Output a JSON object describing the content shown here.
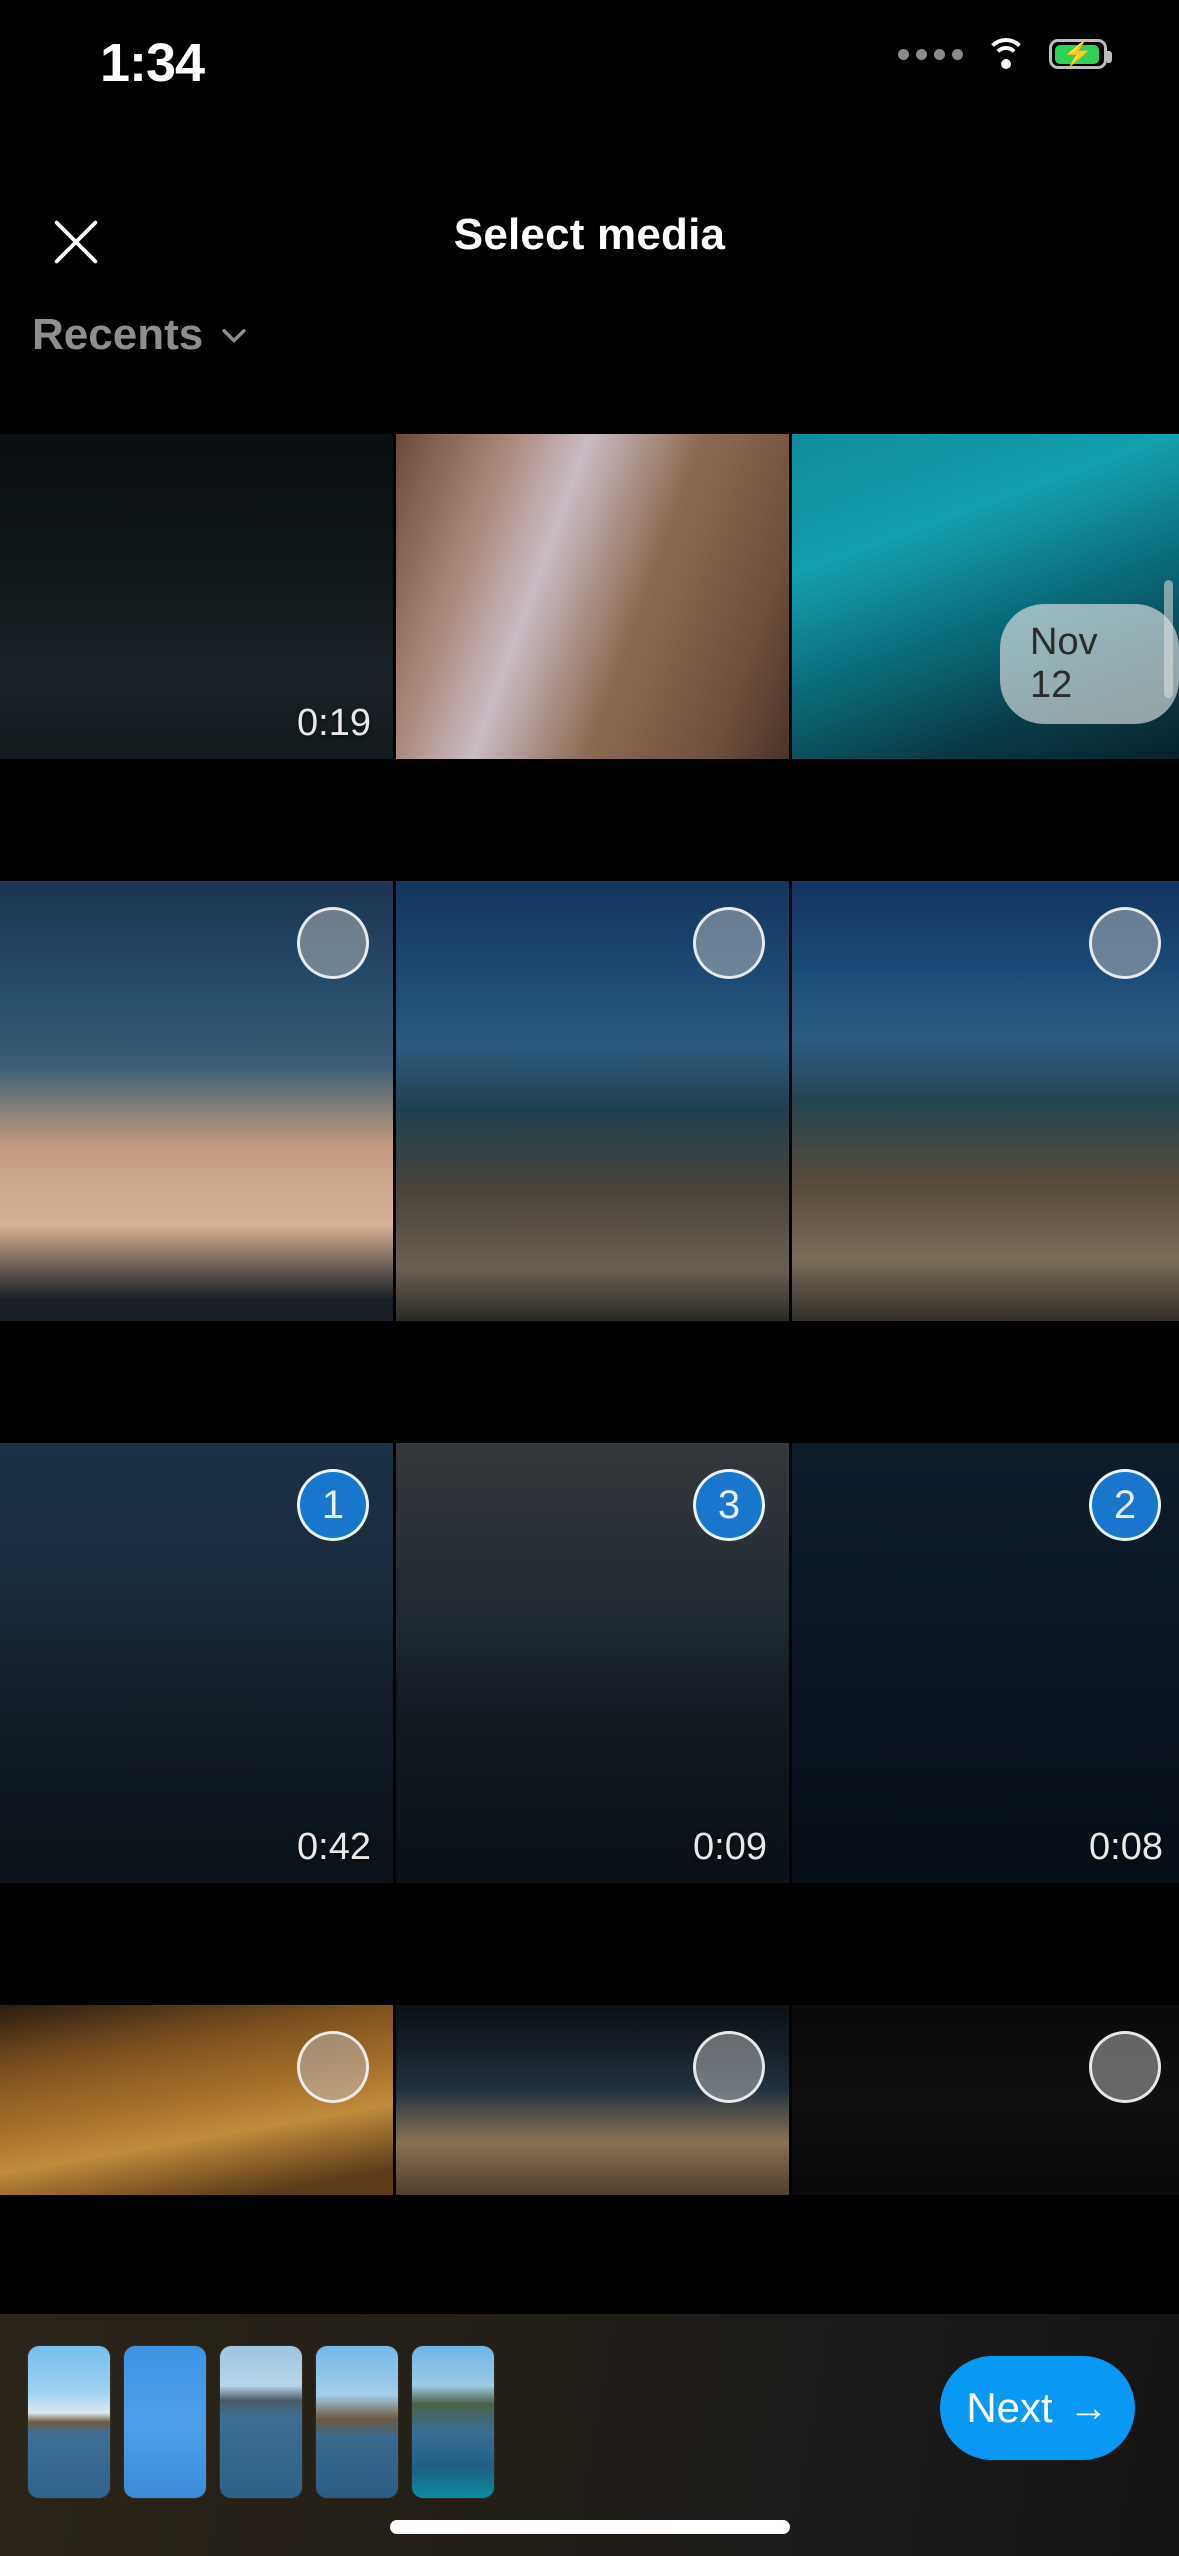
{
  "status_bar": {
    "time": "1:34",
    "signal_icon": "signal-dots-icon",
    "wifi_icon": "wifi-icon",
    "battery_icon": "battery-charging-icon",
    "battery_color": "#30d158"
  },
  "header": {
    "close_icon": "close-icon",
    "title": "Select media",
    "album_label": "Recents",
    "album_chevron_icon": "chevron-down-icon"
  },
  "scrubber": {
    "date_label": "Nov 12",
    "scrollbar_icon": "scrollbar-thumb"
  },
  "grid": {
    "rows": [
      {
        "cells": [
          {
            "name": "media-cell-video-lake-birds",
            "art": "lakedark",
            "duration": "0:19",
            "state": "none"
          },
          {
            "name": "media-cell-portrait-hair",
            "art": "hairshot",
            "duration": "",
            "state": "none"
          },
          {
            "name": "media-cell-kayak-deck-top",
            "art": "kayaktop",
            "duration": "",
            "state": "none"
          }
        ]
      },
      {
        "cells": [
          {
            "name": "media-cell-kayak-legs-water",
            "art": "legsdeck",
            "duration": "",
            "state": "unselected"
          },
          {
            "name": "media-cell-kayak-shore-left",
            "art": "kayakshore1",
            "duration": "",
            "state": "unselected"
          },
          {
            "name": "media-cell-kayak-shore-right",
            "art": "kayakshore2",
            "duration": "",
            "state": "unselected"
          }
        ]
      },
      {
        "cells": [
          {
            "name": "media-cell-video-night-lake-1",
            "art": "nightlake1",
            "duration": "0:42",
            "state": "selected",
            "order": "1"
          },
          {
            "name": "media-cell-video-night-lake-2",
            "art": "nightlake2",
            "duration": "0:09",
            "state": "selected",
            "order": "3"
          },
          {
            "name": "media-cell-video-night-lake-3",
            "art": "nightlake3",
            "duration": "0:08",
            "state": "selected",
            "order": "2"
          }
        ]
      },
      {
        "cells": [
          {
            "name": "media-cell-tabletop-stickers",
            "art": "tabletop",
            "duration": "",
            "state": "unselected"
          },
          {
            "name": "media-cell-kayak-bow",
            "art": "kayakbow",
            "duration": "",
            "state": "unselected"
          },
          {
            "name": "media-cell-dark-frame",
            "art": "darkcell",
            "duration": "",
            "state": "unselected"
          }
        ]
      }
    ]
  },
  "bottom_bar": {
    "thumbnails": [
      {
        "name": "selected-thumb-1",
        "art": "t-lake1"
      },
      {
        "name": "selected-thumb-2",
        "art": "t-sky"
      },
      {
        "name": "selected-thumb-3",
        "art": "t-hill"
      },
      {
        "name": "selected-thumb-4",
        "art": "t-trees"
      },
      {
        "name": "selected-thumb-5",
        "art": "t-kayak"
      }
    ],
    "next_label": "Next",
    "next_arrow": "→",
    "next_color": "#0a98f5",
    "home_indicator": "home-indicator"
  }
}
